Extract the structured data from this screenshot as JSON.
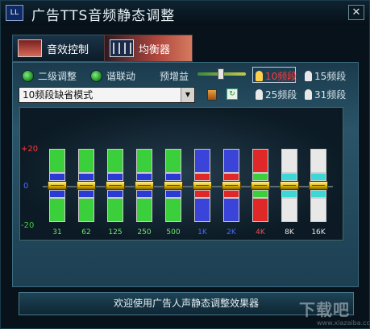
{
  "window": {
    "title": "广告TTS音频静态调整",
    "close_label": "✕",
    "icon_text": "LL"
  },
  "tabs": [
    {
      "label": "音效控制",
      "active": false
    },
    {
      "label": "均衡器",
      "active": true
    }
  ],
  "options": {
    "secondary_adjust": "二级调整",
    "harmonic_link": "谐联动",
    "preamp_label": "预增益",
    "preamp_level": 0.45
  },
  "bands": {
    "b10": "10频段",
    "b15": "15频段",
    "b25": "25频段",
    "b31": "31频段",
    "selected": "10频段"
  },
  "preset": {
    "value": "10频段缺省模式"
  },
  "db_labels": {
    "top": "+20",
    "mid": "0",
    "bottom": "-20"
  },
  "sliders": [
    {
      "freq": "31",
      "color": "#3ccf3c",
      "center": "#2a3ad4",
      "freq_color": "#6ee86e"
    },
    {
      "freq": "62",
      "color": "#3ccf3c",
      "center": "#2a3ad4",
      "freq_color": "#6ee86e"
    },
    {
      "freq": "125",
      "color": "#3ccf3c",
      "center": "#2a3ad4",
      "freq_color": "#6ee86e"
    },
    {
      "freq": "250",
      "color": "#3ccf3c",
      "center": "#2a3ad4",
      "freq_color": "#6ee86e"
    },
    {
      "freq": "500",
      "color": "#3ccf3c",
      "center": "#2a3ad4",
      "freq_color": "#6ee86e"
    },
    {
      "freq": "1K",
      "color": "#3a44d8",
      "center": "#e02828",
      "freq_color": "#4a6aff"
    },
    {
      "freq": "2K",
      "color": "#3a44d8",
      "center": "#e02828",
      "freq_color": "#4a6aff"
    },
    {
      "freq": "4K",
      "color": "#e02828",
      "center": "#3ccf3c",
      "freq_color": "#ff4a4a"
    },
    {
      "freq": "8K",
      "color": "#e8e8e8",
      "center": "#3cd8d8",
      "freq_color": "#e8e8e8"
    },
    {
      "freq": "16K",
      "color": "#e8e8e8",
      "center": "#3cd8d8",
      "freq_color": "#e8e8e8"
    }
  ],
  "status": {
    "text": "欢迎使用广告人声静态调整效果器"
  },
  "watermark": {
    "text": "下载吧",
    "sub": "www.xiazaiba.com"
  },
  "colors": {
    "db_top": "#ff3a3a",
    "db_mid": "#4a6aff",
    "db_bottom": "#3ccf3c",
    "selected_band": "#ff3a3a"
  }
}
